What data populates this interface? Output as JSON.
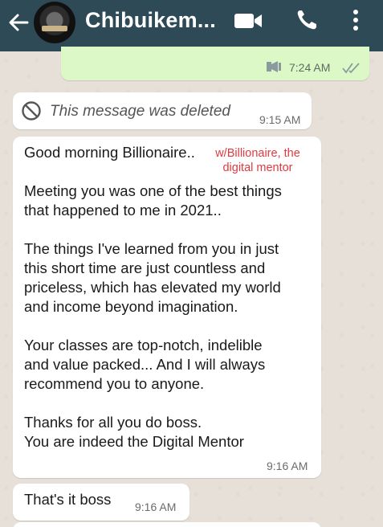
{
  "header": {
    "contact_name": "Chibuikem...",
    "icons": [
      "back-arrow-icon",
      "avatar",
      "video-call-icon",
      "phone-call-icon",
      "more-options-icon"
    ]
  },
  "messages": [
    {
      "id": "outgoing-voice",
      "direction": "outgoing",
      "icon": "voice-note-icon",
      "time": "7:24 AM",
      "status": "read-ticks-icon"
    },
    {
      "id": "deleted",
      "direction": "incoming",
      "text": "This message was deleted",
      "time": "9:15 AM",
      "icon": "blocked-icon"
    },
    {
      "id": "testimonial",
      "direction": "incoming",
      "greeting": "Good morning Billionaire..",
      "watermark": "w/Billionaire, the\ndigital mentor",
      "body": "Meeting you was one of the best things\nthat happened to me in 2021..\n\nThe things I've learned from you in just\nthis short time are just countless and\npriceless, which has elevated my world\nand income beyond imagination.\n\nYour classes are top-notch, indelible\nand value packed... And I will always\nrecommend you to anyone.\n\nThanks for all you do boss.\nYou are indeed the Digital Mentor",
      "time": "9:16 AM"
    },
    {
      "id": "thats-it",
      "direction": "incoming",
      "text": "That's it boss",
      "time": "9:16 AM"
    }
  ],
  "colors": {
    "header_bg": "#2e4a57",
    "outgoing_bubble": "#dcf8c6",
    "incoming_bubble": "#ffffff",
    "chat_bg": "#e6e0d8",
    "watermark": "#e0393e",
    "read_ticks": "#8b9a9f"
  }
}
